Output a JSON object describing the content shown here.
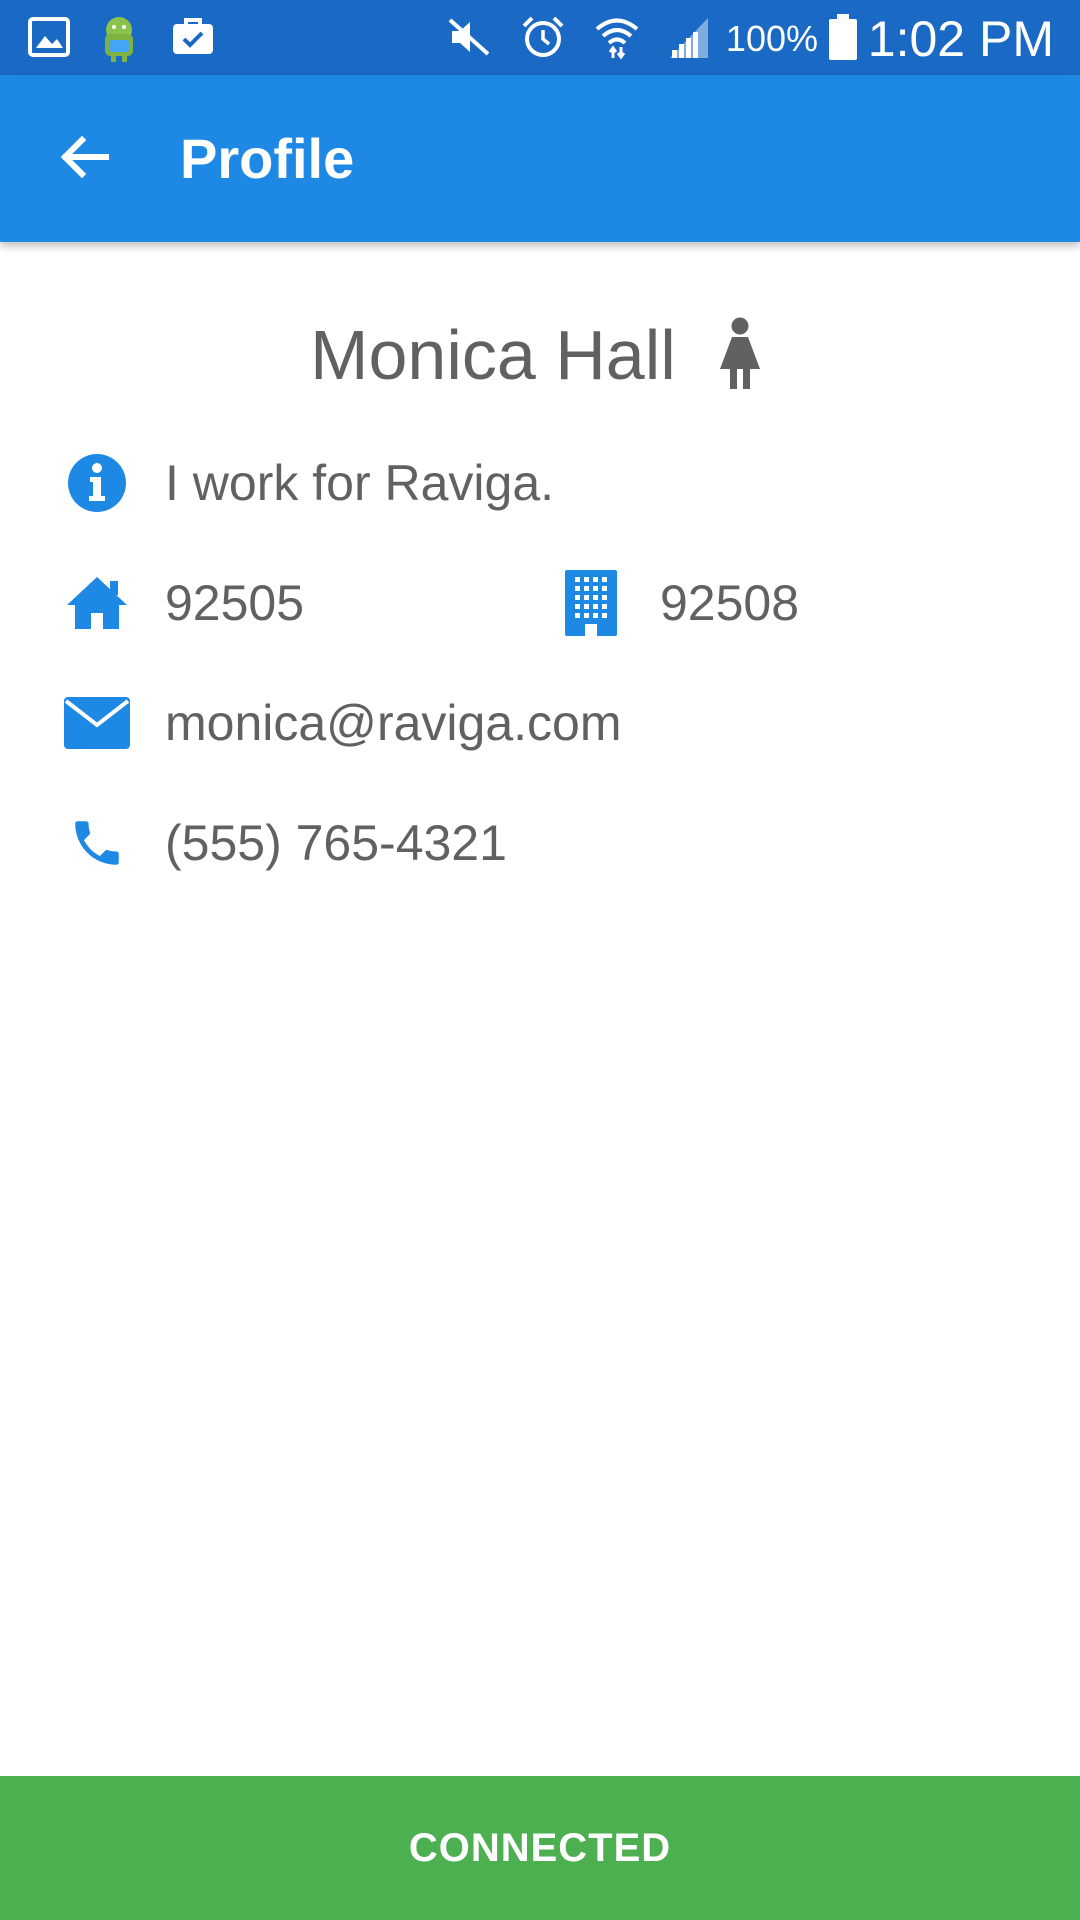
{
  "status_bar": {
    "battery_percent": "100%",
    "time": "1:02 PM",
    "left_icons": [
      "gallery-icon",
      "android-app-icon",
      "briefcase-check-icon"
    ],
    "right_icons": [
      "mute-icon",
      "alarm-icon",
      "wifi-icon",
      "signal-icon",
      "battery-icon"
    ]
  },
  "app_bar": {
    "title": "Profile",
    "back_icon": "arrow-left-icon"
  },
  "profile": {
    "name": "Monica Hall",
    "gender_icon": "female-icon",
    "about": "I work for Raviga.",
    "home_zip": "92505",
    "work_zip": "92508",
    "email": "monica@raviga.com",
    "phone": "(555) 765-4321"
  },
  "connection": {
    "label": "CONNECTED"
  },
  "colors": {
    "status_bar": "#1a69c4",
    "app_bar": "#1e88e5",
    "icon_accent": "#1e88e5",
    "text": "#616161",
    "connected": "#4caf50"
  }
}
